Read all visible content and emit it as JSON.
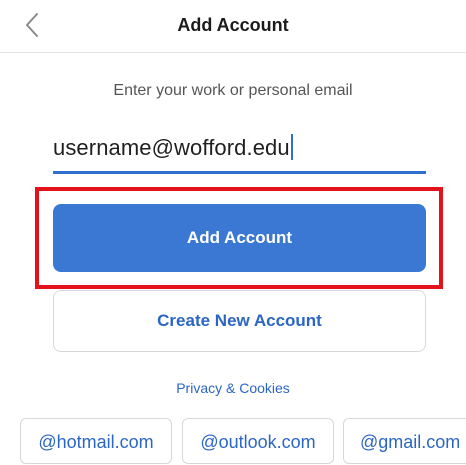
{
  "header": {
    "title": "Add Account",
    "back_icon": "chevron-left-icon"
  },
  "instruction": "Enter your work or personal email",
  "email": {
    "value": "username@wofford.edu"
  },
  "buttons": {
    "add_account": "Add Account",
    "create_account": "Create New Account"
  },
  "privacy_link": "Privacy & Cookies",
  "domain_suggestions": [
    "@hotmail.com",
    "@outlook.com",
    "@gmail.com"
  ],
  "colors": {
    "primary": "#3a78d4",
    "link": "#2b66c4",
    "highlight": "#e3121b"
  }
}
